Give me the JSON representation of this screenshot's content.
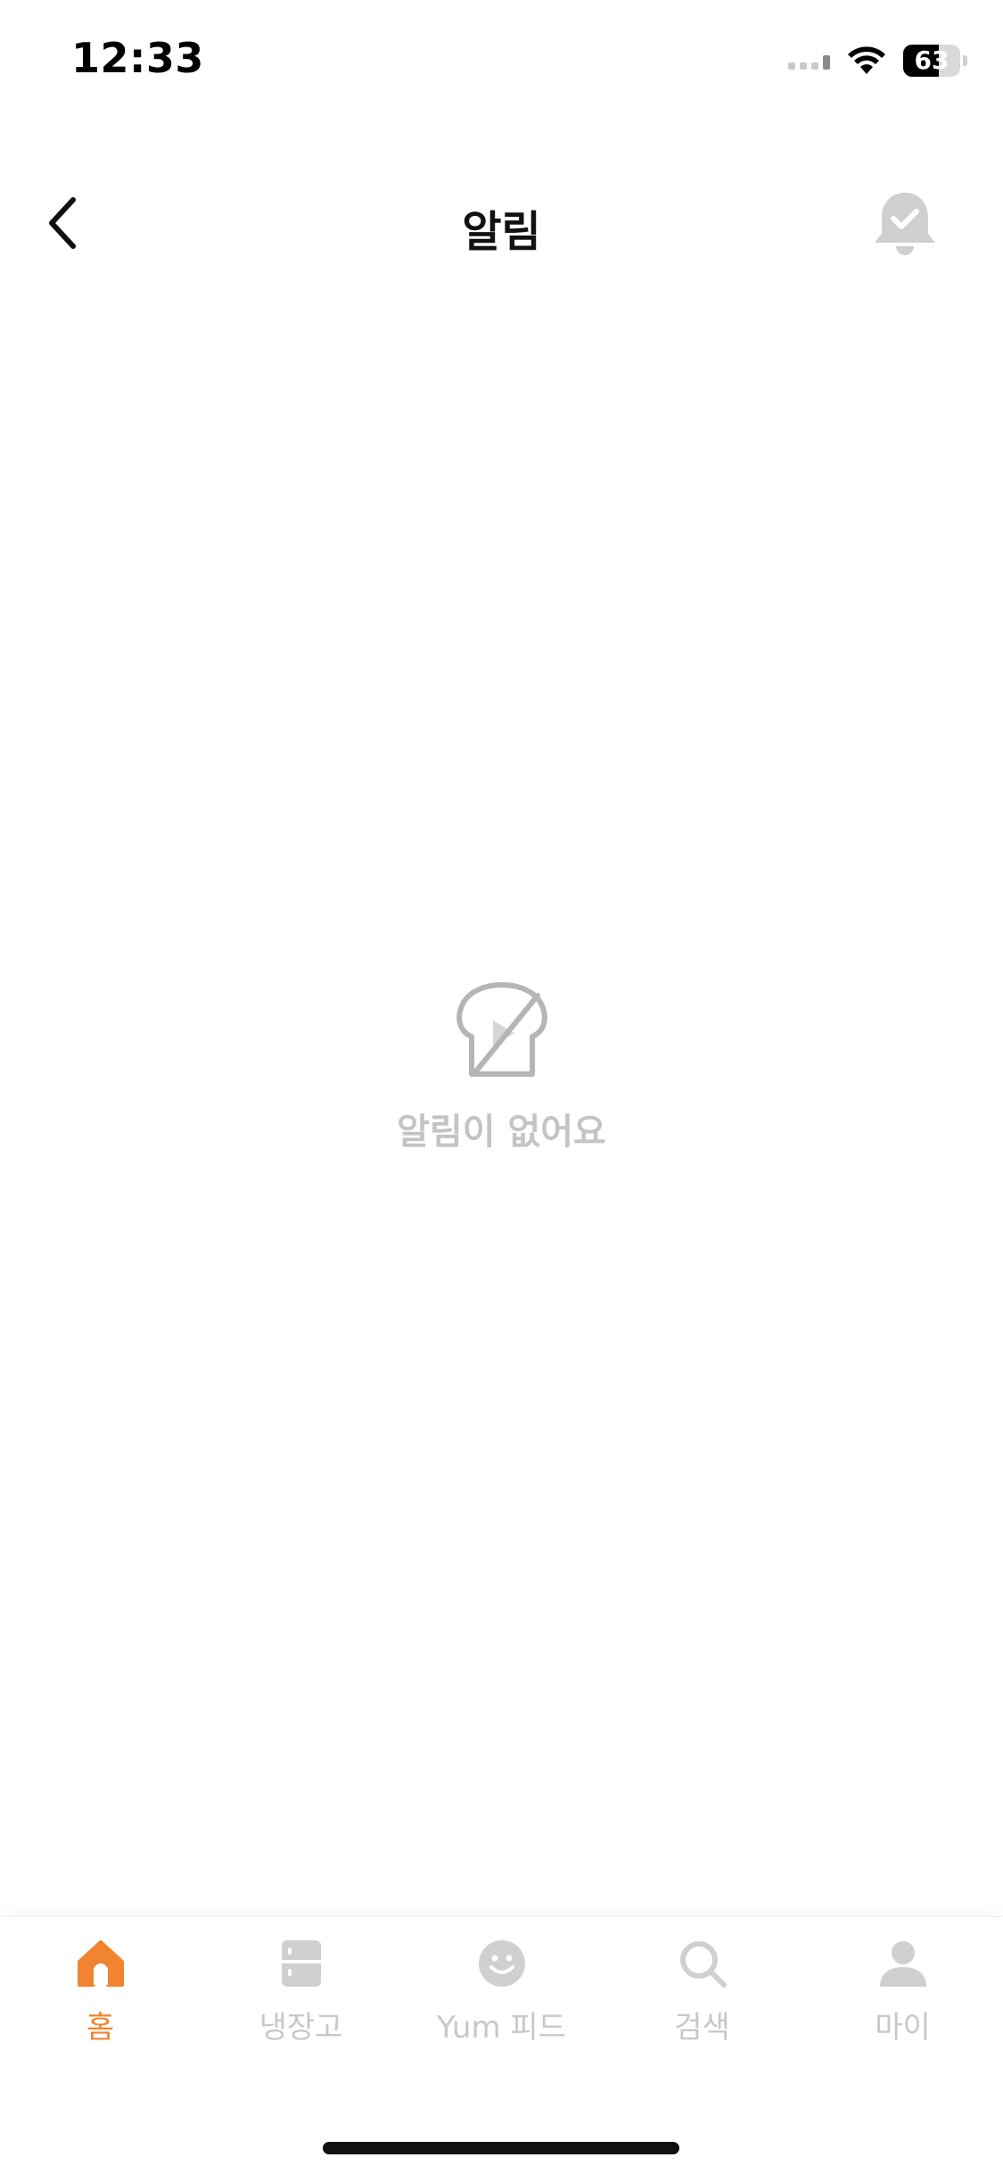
{
  "status_bar": {
    "time": "12:33",
    "battery_level": "63",
    "battery_fraction": 0.63
  },
  "header": {
    "title": "알림",
    "back_icon": "chevron-left-icon",
    "action_icon": "bell-check-icon"
  },
  "empty_state": {
    "icon": "bread-slash-icon",
    "message": "알림이 없어요"
  },
  "tab_bar": {
    "active_color": "#f08430",
    "inactive_color": "#c8c8c8",
    "tabs": [
      {
        "label": "홈",
        "icon": "home-icon",
        "active": true
      },
      {
        "label": "냉장고",
        "icon": "fridge-icon",
        "active": false
      },
      {
        "label": "Yum 피드",
        "icon": "smile-chat-icon",
        "active": false
      },
      {
        "label": "검색",
        "icon": "search-icon",
        "active": false
      },
      {
        "label": "마이",
        "icon": "user-icon",
        "active": false
      }
    ]
  }
}
